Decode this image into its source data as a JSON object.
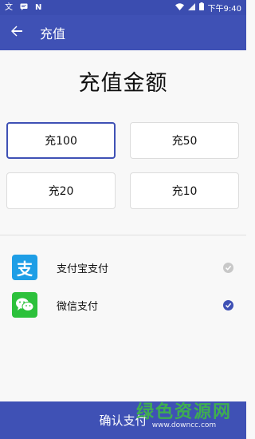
{
  "status_bar": {
    "icons_left": [
      "translate-icon",
      "message-icon",
      "n-icon"
    ],
    "time": "下午9:40",
    "icons_right": [
      "wifi-icon",
      "signal-icon",
      "battery-icon"
    ]
  },
  "app_bar": {
    "title": "充值",
    "back_icon": "arrow-left-icon"
  },
  "heading": "充值金额",
  "amounts": [
    {
      "label": "充100",
      "selected": true
    },
    {
      "label": "充50",
      "selected": false
    },
    {
      "label": "充20",
      "selected": false
    },
    {
      "label": "充10",
      "selected": false
    }
  ],
  "payment_methods": [
    {
      "label": "支付宝支付",
      "logo": "alipay-logo",
      "logo_text": "支",
      "color": "#1e9ee6",
      "checked": false
    },
    {
      "label": "微信支付",
      "logo": "wechat-logo",
      "color": "#2cc13b",
      "checked": true
    }
  ],
  "confirm_button": "确认支付",
  "watermark": {
    "main": "绿色资源网",
    "sub": "www.downcc.com"
  },
  "colors": {
    "primary": "#3f51b5",
    "status_bar": "#3b4db0",
    "check_active": "#3f51b5",
    "check_inactive": "#c8c8c8"
  }
}
